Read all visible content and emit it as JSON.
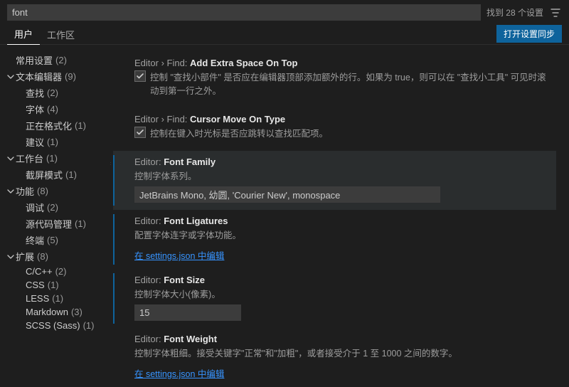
{
  "search": {
    "value": "font",
    "results_text": "找到 28 个设置"
  },
  "tabs": {
    "user": "用户",
    "workspace": "工作区",
    "sync_button": "打开设置同步"
  },
  "tree": [
    {
      "level": 0,
      "twisty": "",
      "label": "常用设置",
      "count": "(2)"
    },
    {
      "level": 1,
      "twisty": "v",
      "label": "文本编辑器",
      "count": "(9)"
    },
    {
      "level": 2,
      "twisty": "",
      "label": "查找",
      "count": "(2)"
    },
    {
      "level": 2,
      "twisty": "",
      "label": "字体",
      "count": "(4)"
    },
    {
      "level": 2,
      "twisty": "",
      "label": "正在格式化",
      "count": "(1)"
    },
    {
      "level": 2,
      "twisty": "",
      "label": "建议",
      "count": "(1)"
    },
    {
      "level": 1,
      "twisty": "v",
      "label": "工作台",
      "count": "(1)"
    },
    {
      "level": 2,
      "twisty": "",
      "label": "截屏模式",
      "count": "(1)"
    },
    {
      "level": 1,
      "twisty": "v",
      "label": "功能",
      "count": "(8)"
    },
    {
      "level": 2,
      "twisty": "",
      "label": "调试",
      "count": "(2)"
    },
    {
      "level": 2,
      "twisty": "",
      "label": "源代码管理",
      "count": "(1)"
    },
    {
      "level": 2,
      "twisty": "",
      "label": "终端",
      "count": "(5)"
    },
    {
      "level": 1,
      "twisty": "v",
      "label": "扩展",
      "count": "(8)"
    },
    {
      "level": 2,
      "twisty": "",
      "label": "C/C++",
      "count": "(2)"
    },
    {
      "level": 2,
      "twisty": "",
      "label": "CSS",
      "count": "(1)"
    },
    {
      "level": 2,
      "twisty": "",
      "label": "LESS",
      "count": "(1)"
    },
    {
      "level": 2,
      "twisty": "",
      "label": "Markdown",
      "count": "(3)"
    },
    {
      "level": 2,
      "twisty": "",
      "label": "SCSS (Sass)",
      "count": "(1)"
    }
  ],
  "settings": {
    "find_extra_space": {
      "crumb": "Editor › Find: ",
      "key": "Add Extra Space On Top",
      "desc": "控制 \"查找小部件\" 是否应在编辑器顶部添加额外的行。如果为 true，则可以在 \"查找小工具\" 可见时滚动到第一行之外。",
      "checked": true
    },
    "find_cursor_move": {
      "crumb": "Editor › Find: ",
      "key": "Cursor Move On Type",
      "desc": "控制在键入时光标是否应跳转以查找匹配项。",
      "checked": true
    },
    "font_family": {
      "crumb": "Editor: ",
      "key": "Font Family",
      "desc": "控制字体系列。",
      "value": "JetBrains Mono, 幼圆, 'Courier New', monospace"
    },
    "font_ligatures": {
      "crumb": "Editor: ",
      "key": "Font Ligatures",
      "desc": "配置字体连字或字体功能。",
      "link": "在 settings.json 中编辑"
    },
    "font_size": {
      "crumb": "Editor: ",
      "key": "Font Size",
      "desc": "控制字体大小(像素)。",
      "value": "15"
    },
    "font_weight": {
      "crumb": "Editor: ",
      "key": "Font Weight",
      "desc": "控制字体粗细。接受关键字\"正常\"和\"加粗\"，或者接受介于 1 至 1000 之间的数字。",
      "link": "在 settings.json 中编辑"
    }
  }
}
